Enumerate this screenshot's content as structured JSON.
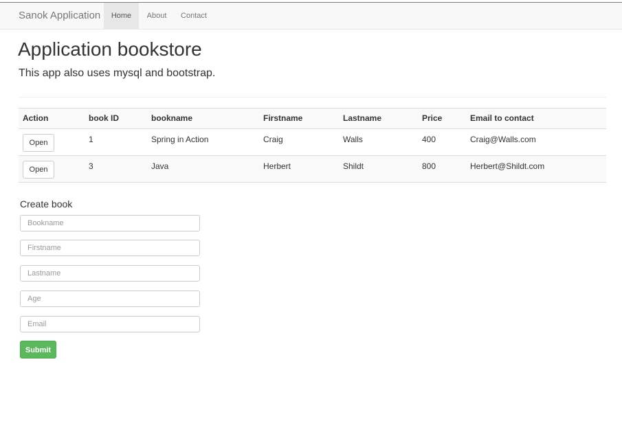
{
  "navbar": {
    "brand": "Sanok Application",
    "links": [
      "Home",
      "About",
      "Contact"
    ],
    "active": "Home"
  },
  "header": {
    "title": "Application bookstore",
    "subtitle": "This app also uses mysql and bootstrap."
  },
  "table": {
    "columns": [
      "Action",
      "book ID",
      "bookname",
      "Firstname",
      "Lastname",
      "Price",
      "Email to contact"
    ],
    "rows": [
      {
        "action": "Open",
        "id": "1",
        "bookname": "Spring in Action",
        "firstname": "Craig",
        "lastname": "Walls",
        "price": "400",
        "email": "Craig@Walls.com"
      },
      {
        "action": "Open",
        "id": "3",
        "bookname": "Java",
        "firstname": "Herbert",
        "lastname": "Shildt",
        "price": "800",
        "email": "Herbert@Shildt.com"
      }
    ]
  },
  "form": {
    "title": "Create book",
    "fields": [
      {
        "placeholder": "Bookname",
        "value": ""
      },
      {
        "placeholder": "Firstname",
        "value": ""
      },
      {
        "placeholder": "Lastname",
        "value": ""
      },
      {
        "placeholder": "Age",
        "value": ""
      },
      {
        "placeholder": "Email",
        "value": ""
      }
    ],
    "submit_label": "Submit"
  },
  "colors": {
    "navbar_bg": "#f8f8f8",
    "active_nav_bg": "#e7e7e7",
    "submit_green": "#5cb85c"
  }
}
